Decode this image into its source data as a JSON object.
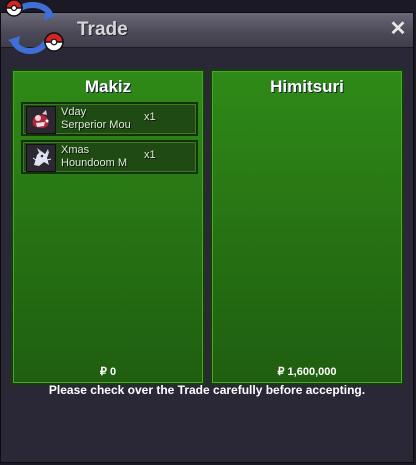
{
  "window": {
    "title": "Trade",
    "close_icon": "close-icon",
    "close_glyph": "✕",
    "logo_icon": "pokeball-swap-icon"
  },
  "left_panel": {
    "trader_name": "Makiz",
    "items": [
      {
        "line1": "Vday",
        "line2": "Serperior Mou",
        "qty": "x1",
        "icon": "serperior-mount-icon"
      },
      {
        "line1": "Xmas",
        "line2": "Houndoom M",
        "qty": "x1",
        "icon": "houndoom-mount-icon"
      }
    ],
    "money": "₽ 0"
  },
  "right_panel": {
    "trader_name": "Himitsuri",
    "items": [],
    "money": "₽ 1,600,000"
  },
  "footer": {
    "message": "Please check over the Trade carefully before accepting."
  },
  "colors": {
    "panel_green": "#2f8a17",
    "window_bg": "#2a2736",
    "title_bar": "#58556a"
  }
}
